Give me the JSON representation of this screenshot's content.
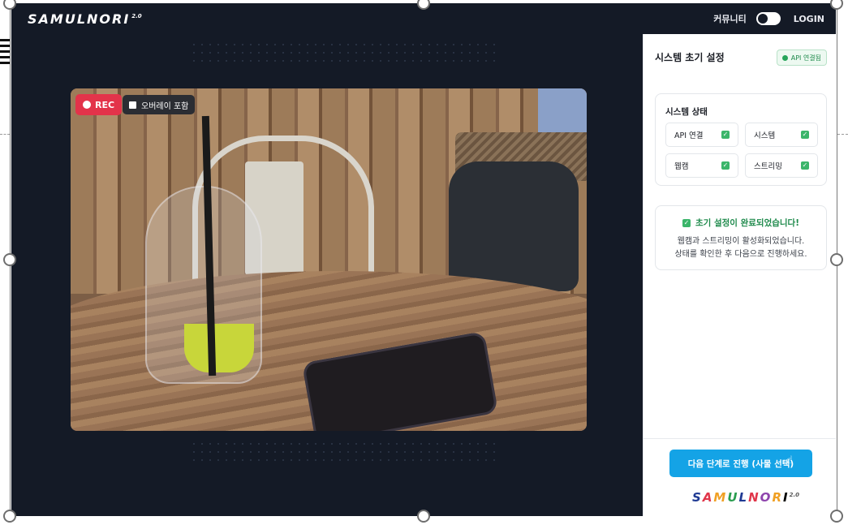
{
  "app": {
    "logo_text": "SAMULNORI",
    "logo_sup": "2.0",
    "nav_community": "커뮤니티",
    "nav_login": "LOGIN"
  },
  "video": {
    "rec_label": "REC",
    "overlay_label": "오버레이 포함"
  },
  "panel": {
    "title": "시스템 초기 설정",
    "api_badge": "API 연결됨",
    "status_title": "시스템 상태",
    "status_items": [
      {
        "label": "API 연결",
        "checked": true
      },
      {
        "label": "시스템",
        "checked": true
      },
      {
        "label": "웹캠",
        "checked": true
      },
      {
        "label": "스트리밍",
        "checked": true
      }
    ],
    "done_title": "초기 설정이 완료되었습니다!",
    "done_desc_1": "웹캠과 스트리밍이 활성화되었습니다.",
    "done_desc_2": "상태를 확인한 후 다음으로 진행하세요.",
    "next_button": "다음 단계로 진행 (사물 선택)",
    "footer_logo": [
      "S",
      "A",
      "M",
      "U",
      "L",
      "N",
      "O",
      "R",
      "I"
    ],
    "footer_logo_sup": "2.0"
  },
  "colors": {
    "app_bg": "#141a26",
    "rec_red": "#e3334a",
    "success_green": "#1f8a4c",
    "primary_blue": "#14a3e6"
  },
  "icons": {
    "check": "check-icon",
    "cursor": "pointer-cursor-icon",
    "rec_dot": "record-dot-icon",
    "overlay_box": "checkbox-icon"
  }
}
